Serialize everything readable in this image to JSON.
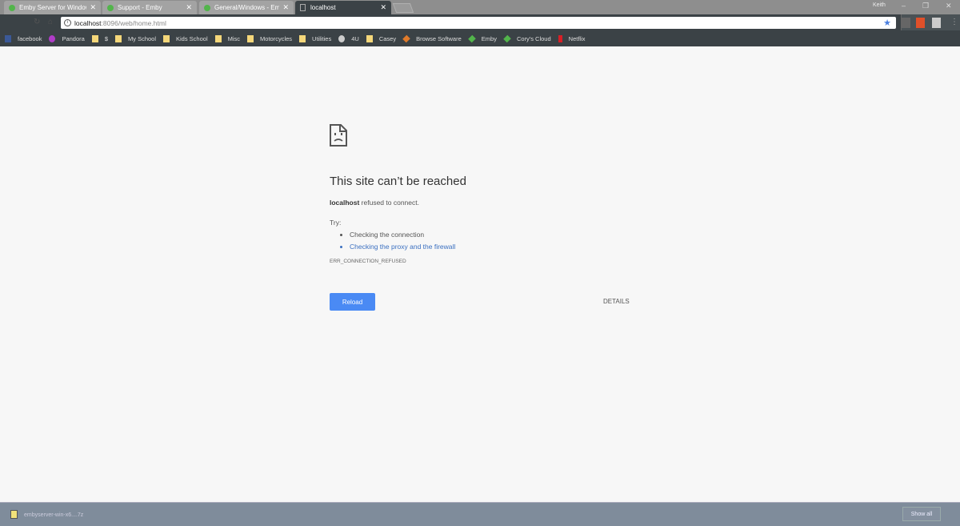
{
  "tabs": [
    {
      "title": "Emby Server for Windows",
      "icon": "emby-icon"
    },
    {
      "title": "Support - Emby",
      "icon": "emby-icon"
    },
    {
      "title": "General/Windows - Emby",
      "icon": "emby-icon"
    },
    {
      "title": "localhost",
      "icon": "document-icon",
      "active": true
    }
  ],
  "profile": "Keith",
  "omnibox": {
    "host": "localhost",
    "path": ":8096/web/home.html"
  },
  "bookmarks": [
    "facebook",
    "Pandora",
    "$",
    "My School",
    "Kids School",
    "Misc",
    "Motorcycles",
    "Utilities",
    "4U",
    "Casey",
    "Browse Software",
    "Emby",
    "Cory's Cloud",
    "Netflix"
  ],
  "error": {
    "title": "This site can’t be reached",
    "host": "localhost",
    "message": " refused to connect.",
    "try": "Try:",
    "suggestions": [
      "Checking the connection",
      "Checking the proxy and the firewall"
    ],
    "code": "ERR_CONNECTION_REFUSED",
    "reload": "Reload",
    "details": "DETAILS"
  },
  "download": {
    "filename": "embyserver-win-x6....7z",
    "show_all": "Show all"
  },
  "colors": {
    "accent": "#4a8af4",
    "link": "#3a6fc0"
  }
}
